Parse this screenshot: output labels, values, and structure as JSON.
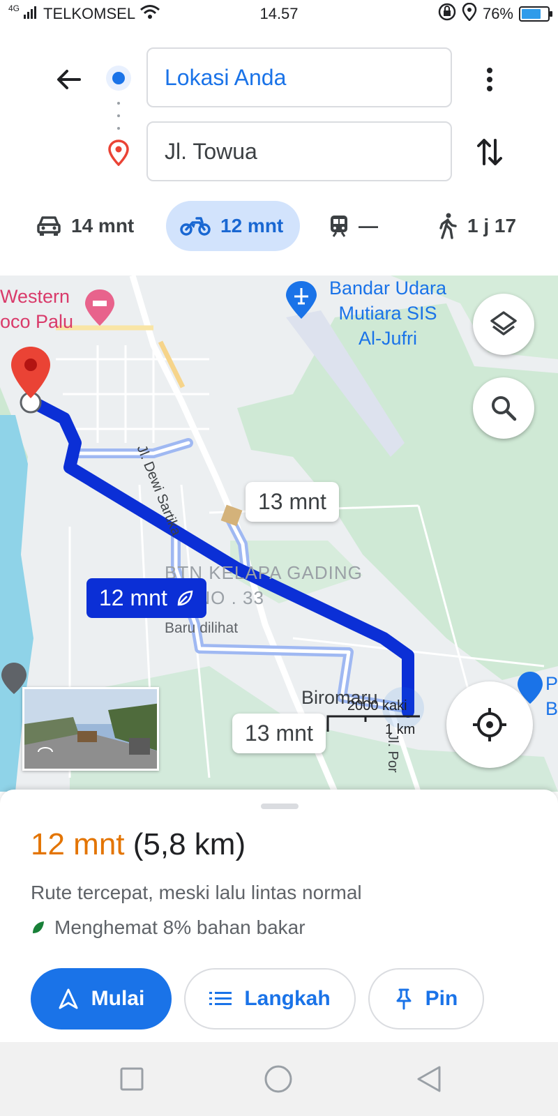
{
  "status_bar": {
    "network": "4G",
    "carrier": "TELKOMSEL",
    "time": "14.57",
    "battery": "76%",
    "battery_level": 0.76
  },
  "directions": {
    "origin": "Lokasi Anda",
    "destination": "Jl. Towua"
  },
  "modes": [
    {
      "name": "car",
      "label": "14 mnt"
    },
    {
      "name": "motorcycle",
      "label": "12 mnt",
      "selected": true
    },
    {
      "name": "transit",
      "label": "—"
    },
    {
      "name": "walk",
      "label": "1 j 17"
    }
  ],
  "map": {
    "hotel_line1": "Western",
    "hotel_line2": "oco Palu",
    "airport_line1": "Bandar Udara",
    "airport_line2": "Mutiara SIS",
    "airport_line3": "Al-Jufri",
    "street_dewi": "Jl. Dewi Sartika",
    "street_por": "Jl. Por",
    "poi_line1": "BTN KELAPA GADING",
    "poi_line2": "AN NO . 33",
    "recent_label": "Baru dilihat",
    "place_biromaru": "Biromaru",
    "scale_feet": "2000 kaki",
    "scale_km": "1 km",
    "alt_route_1": "13 mnt",
    "alt_route_2": "13 mnt",
    "main_route": "12 mnt",
    "edge_label_1": "P",
    "edge_label_2": "B"
  },
  "sheet": {
    "duration": "12 mnt",
    "distance": "(5,8 km)",
    "description": "Rute tercepat, meski lalu lintas normal",
    "fuel": "Menghemat 8% bahan bakar"
  },
  "buttons": {
    "start": "Mulai",
    "steps": "Langkah",
    "pin": "Pin"
  },
  "colors": {
    "accent": "#1a73e8",
    "route": "#0b2fd6",
    "duration": "#e37400",
    "destination_pin": "#ea4335"
  }
}
